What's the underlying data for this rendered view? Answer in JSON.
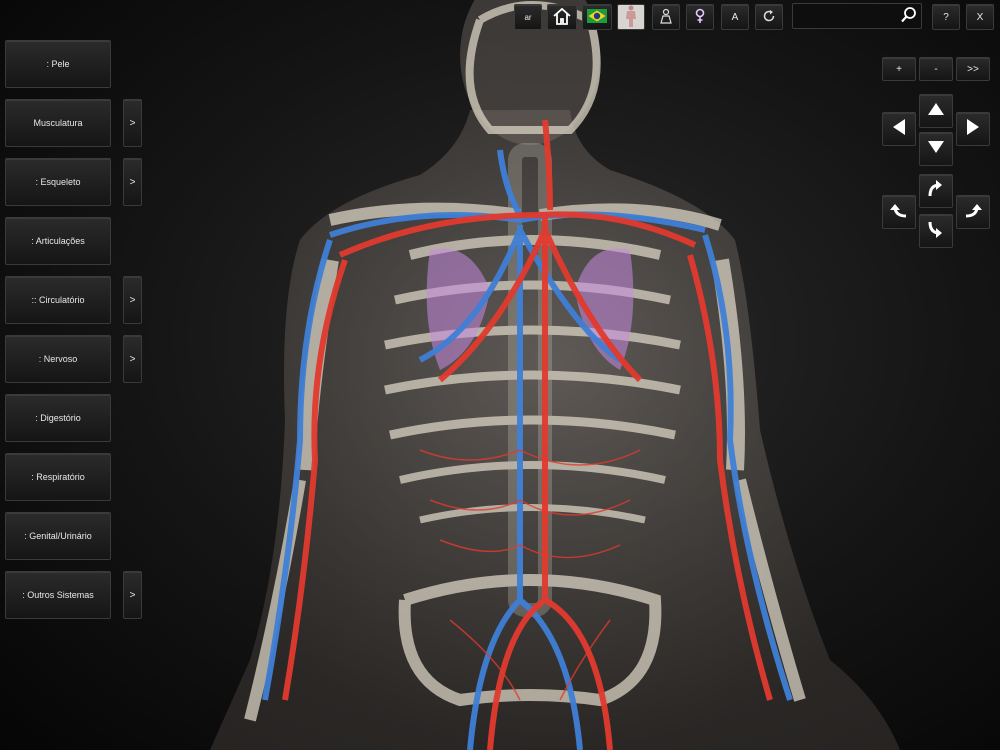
{
  "toolbar": {
    "lang_label": "ar",
    "home_icon": "home-icon",
    "flag_icon": "brazil-flag-icon",
    "body_thumb_icon": "body-thumbnail-icon",
    "person_icon": "person-outline-icon",
    "female_icon": "female-symbol-icon",
    "text_label": "A",
    "reset_icon": "rotate-reset-icon",
    "search_value": "",
    "search_icon": "search-icon",
    "help_label": "?",
    "close_label": "X"
  },
  "zoom": {
    "in_label": "+",
    "out_label": "-",
    "next_label": ">>"
  },
  "pan": [
    "up-arrow-icon",
    "left-arrow-icon",
    "right-arrow-icon",
    "down-arrow-icon"
  ],
  "rotate": [
    "rotate-up-icon",
    "rotate-left-icon",
    "rotate-right-icon",
    "rotate-down-icon"
  ],
  "sidebar": {
    "items": [
      {
        "label": ": Pele",
        "sub": ""
      },
      {
        "label": "Musculatura",
        "sub": ">"
      },
      {
        "label": ": Esqueleto",
        "sub": ">"
      },
      {
        "label": ": Articulações",
        "sub": ""
      },
      {
        "label": ":: Circulatório",
        "sub": ">"
      },
      {
        "label": ": Nervoso",
        "sub": ">"
      },
      {
        "label": ": Digestório",
        "sub": ""
      },
      {
        "label": ": Respiratório",
        "sub": ""
      },
      {
        "label": ": Genital/Urinário",
        "sub": ""
      },
      {
        "label": ": Outros Sistemas",
        "sub": ">"
      }
    ]
  },
  "viewer": {
    "model": "anatomy-3d-model"
  },
  "colors": {
    "artery": "#e23a2e",
    "vein": "#3f7fd6",
    "bone": "#d9d3c3",
    "skin": "#7a7068",
    "lung": "#c78be0"
  }
}
